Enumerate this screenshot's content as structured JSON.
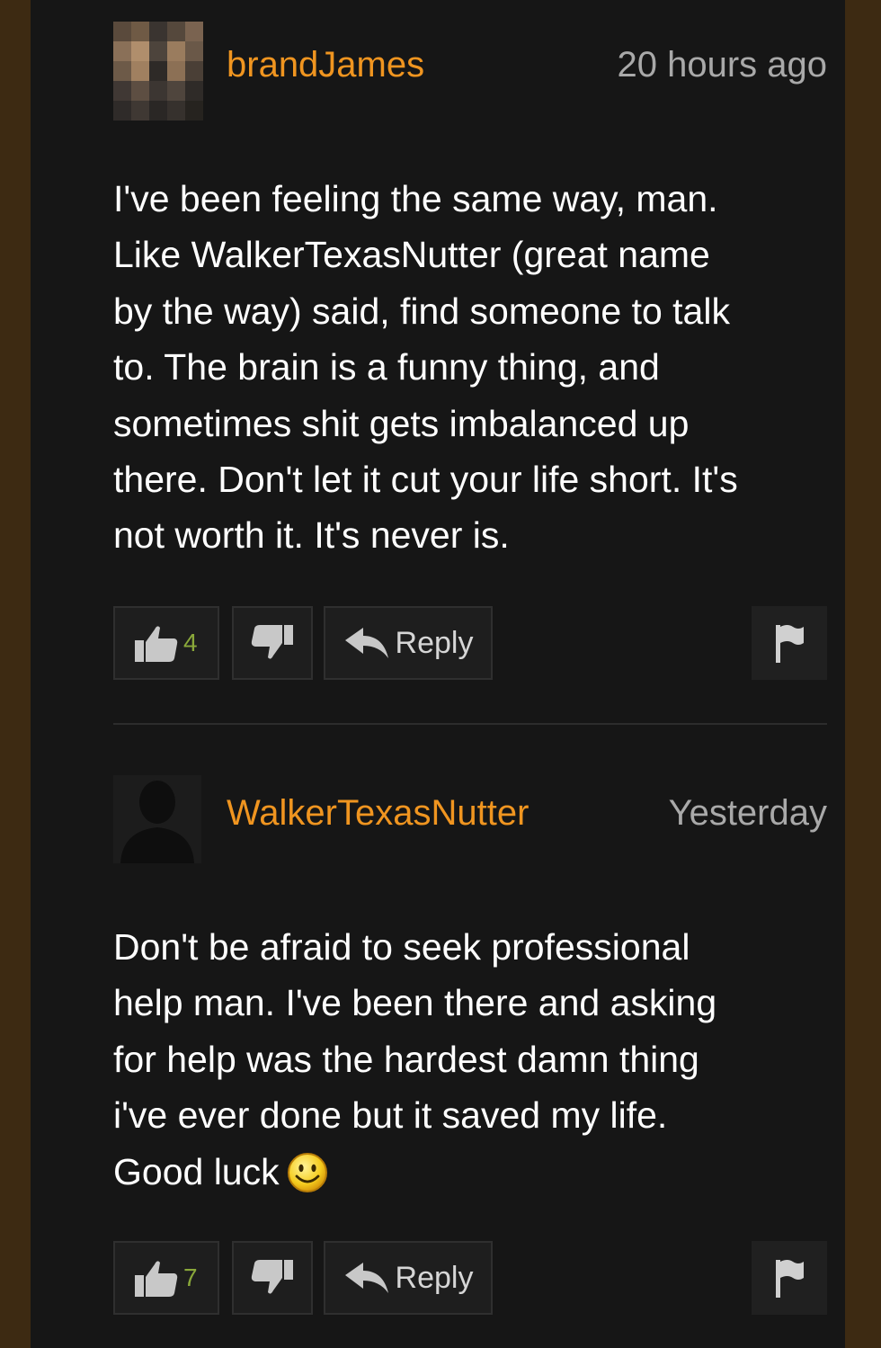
{
  "comments": [
    {
      "username": "brandJames",
      "timestamp": "20 hours ago",
      "body": "I've been feeling the same way, man.\nLike WalkerTexasNutter (great name\nby the way) said, find someone to talk\nto. The brain is a funny thing, and\nsometimes shit gets imbalanced up\nthere. Don't let it cut your life short. It's\nnot worth it. It's never is.",
      "upvotes": "4",
      "reply_label": "Reply",
      "avatar": "pixelated-photo"
    },
    {
      "username": "WalkerTexasNutter",
      "timestamp": "Yesterday",
      "body": "Don't be afraid to seek professional\nhelp man. I've been there and asking\nfor help was the hardest damn thing\ni've ever done but it saved my life.\nGood luck",
      "upvotes": "7",
      "reply_label": "Reply",
      "avatar": "default-silhouette"
    }
  ],
  "icons": {
    "thumbs_up": "thumbs-up-icon",
    "thumbs_down": "thumbs-down-icon",
    "reply": "reply-arrow-icon",
    "flag": "flag-icon",
    "emoji": "smiley-emoji"
  },
  "colors": {
    "username": "#f09520",
    "timestamp": "#a9a9a9",
    "upvote_count": "#8aa83a",
    "panel_bg": "#161616",
    "frame_bg": "#3d2a12"
  }
}
